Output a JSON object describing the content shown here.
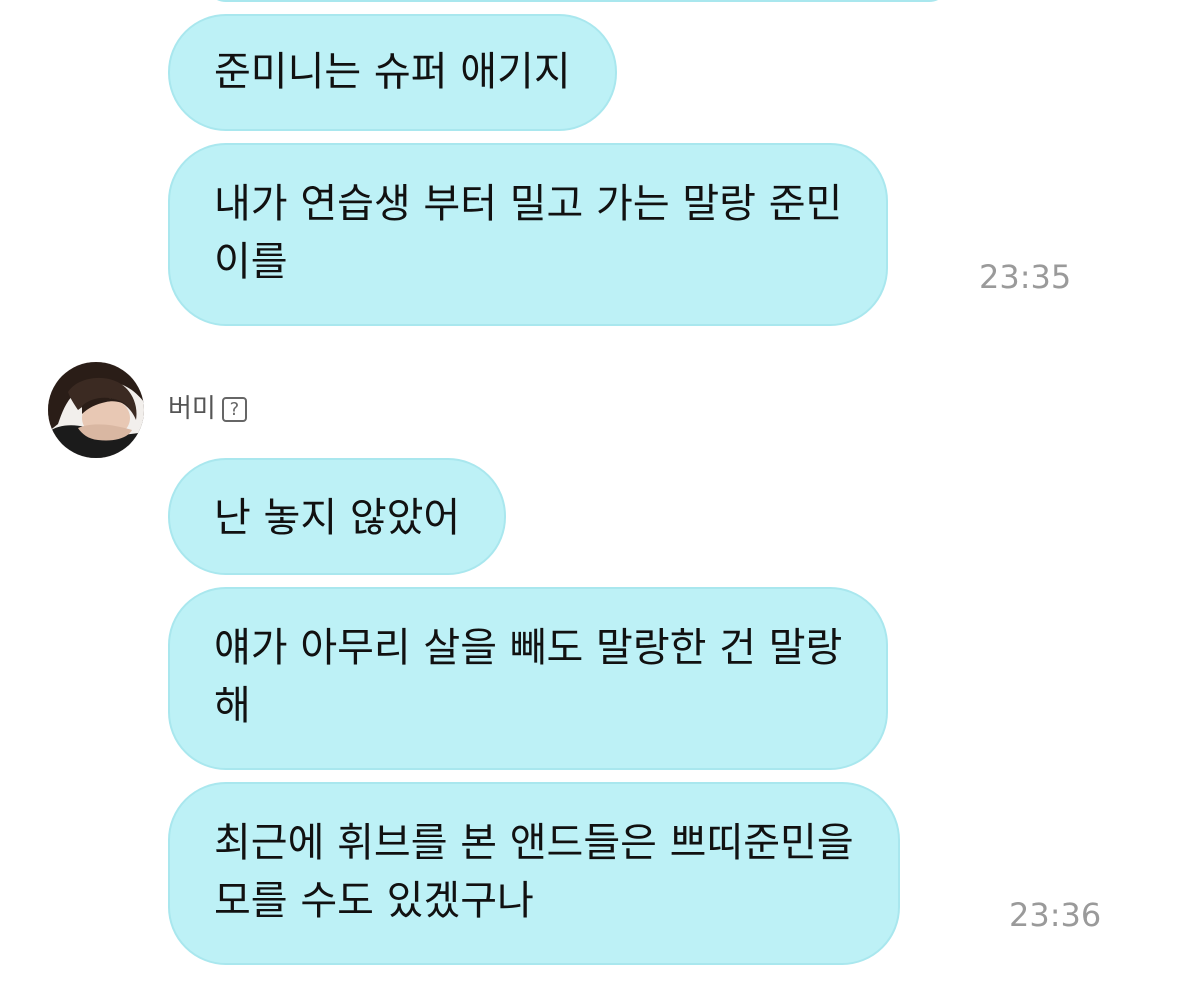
{
  "messages_before": [
    {
      "text": "준미니는 슈퍼 애기지"
    },
    {
      "lines": [
        "내가 연습생 부터 밀고 가는 말랑 준민",
        "이를"
      ],
      "time": "23:35"
    }
  ],
  "sender": {
    "name": "버미",
    "help_icon_glyph": "?"
  },
  "messages_after": [
    {
      "text": "난 놓지 않았어"
    },
    {
      "lines": [
        "얘가 아무리 살을 빼도 말랑한 건 말랑",
        "해"
      ]
    },
    {
      "lines": [
        "최근에 휘브를 본 앤드들은 쁘띠준민을",
        "모를 수도 있겠구나"
      ],
      "time": "23:36"
    }
  ],
  "colors": {
    "bubble": "#bdf1f6",
    "bubble_border": "#a9e7ee",
    "timestamp": "#9a9a9a"
  }
}
